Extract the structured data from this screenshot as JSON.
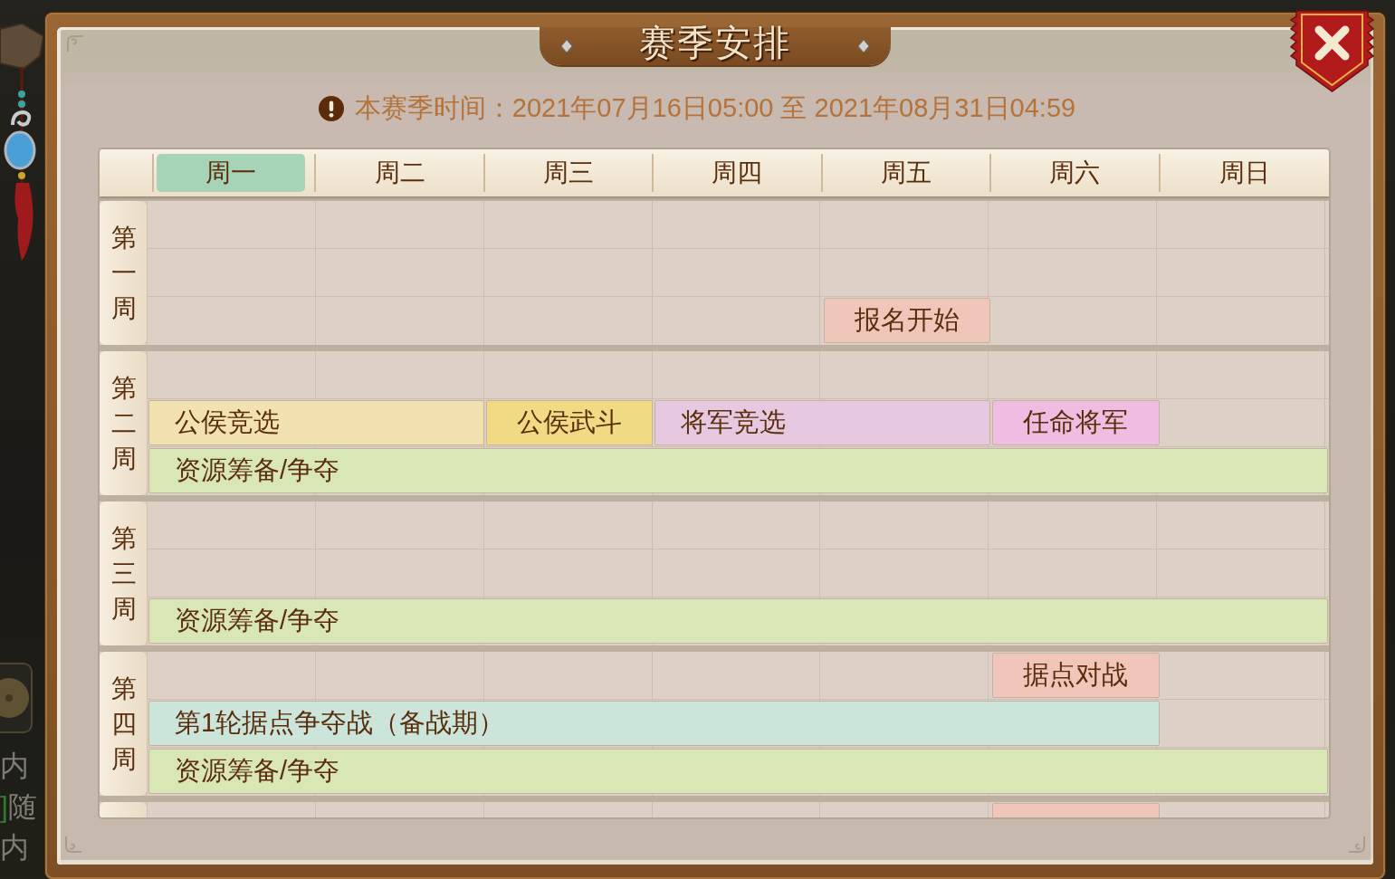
{
  "scene": {
    "chat_lines": [
      {
        "text": "内"
      },
      {
        "tag": "]",
        "text": "随"
      },
      {
        "text": "内"
      }
    ]
  },
  "dialog": {
    "title": "赛季安排",
    "notice": "本赛季时间：2021年07月16日05:00 至 2021年08月31日04:59"
  },
  "schedule": {
    "days": [
      {
        "label": "周一",
        "selected": true
      },
      {
        "label": "周二",
        "selected": false
      },
      {
        "label": "周三",
        "selected": false
      },
      {
        "label": "周四",
        "selected": false
      },
      {
        "label": "周五",
        "selected": false
      },
      {
        "label": "周六",
        "selected": false
      },
      {
        "label": "周日",
        "selected": false
      }
    ],
    "weeks": [
      {
        "label": "第一周",
        "lanes": [
          [
            {
              "kind": "empty"
            },
            {
              "kind": "empty"
            },
            {
              "kind": "empty"
            },
            {
              "kind": "empty"
            },
            {
              "kind": "empty"
            },
            {
              "kind": "empty"
            },
            {
              "kind": "empty"
            }
          ],
          [
            {
              "kind": "empty"
            },
            {
              "kind": "empty"
            },
            {
              "kind": "empty"
            },
            {
              "kind": "empty"
            },
            {
              "kind": "empty"
            },
            {
              "kind": "empty"
            },
            {
              "kind": "empty"
            }
          ],
          [
            {
              "kind": "empty"
            },
            {
              "kind": "empty"
            },
            {
              "kind": "empty"
            },
            {
              "kind": "empty"
            },
            {
              "kind": "event",
              "label": "报名开始",
              "color": "#f1c6ba"
            },
            {
              "kind": "empty"
            },
            {
              "kind": "empty"
            }
          ]
        ]
      },
      {
        "label": "第二周",
        "lanes": [
          [
            {
              "kind": "empty"
            },
            {
              "kind": "empty"
            },
            {
              "kind": "empty"
            },
            {
              "kind": "empty"
            },
            {
              "kind": "empty"
            },
            {
              "kind": "empty"
            },
            {
              "kind": "empty"
            }
          ],
          [
            {
              "kind": "event",
              "label": "公侯竞选",
              "color": "#f2e2b0"
            },
            {
              "kind": "continued"
            },
            {
              "kind": "event",
              "label": "公侯武斗",
              "color": "#f1da84"
            },
            {
              "kind": "event",
              "label": "将军竞选",
              "color": "#e6c9e1"
            },
            {
              "kind": "continued"
            },
            {
              "kind": "event",
              "label": "任命将军",
              "color": "#efbde2"
            },
            {
              "kind": "empty"
            }
          ],
          [
            {
              "kind": "event",
              "label": "资源筹备/争夺",
              "color": "#d9e6b6"
            },
            {
              "kind": "continued"
            },
            {
              "kind": "continued"
            },
            {
              "kind": "continued"
            },
            {
              "kind": "continued"
            },
            {
              "kind": "continued"
            },
            {
              "kind": "continued"
            }
          ]
        ]
      },
      {
        "label": "第三周",
        "lanes": [
          [
            {
              "kind": "empty"
            },
            {
              "kind": "empty"
            },
            {
              "kind": "empty"
            },
            {
              "kind": "empty"
            },
            {
              "kind": "empty"
            },
            {
              "kind": "empty"
            },
            {
              "kind": "empty"
            }
          ],
          [
            {
              "kind": "empty"
            },
            {
              "kind": "empty"
            },
            {
              "kind": "empty"
            },
            {
              "kind": "empty"
            },
            {
              "kind": "empty"
            },
            {
              "kind": "empty"
            },
            {
              "kind": "empty"
            }
          ],
          [
            {
              "kind": "event",
              "label": "资源筹备/争夺",
              "color": "#d9e6b6"
            },
            {
              "kind": "continued"
            },
            {
              "kind": "continued"
            },
            {
              "kind": "continued"
            },
            {
              "kind": "continued"
            },
            {
              "kind": "continued"
            },
            {
              "kind": "continued"
            }
          ]
        ]
      },
      {
        "label": "第四周",
        "lanes": [
          [
            {
              "kind": "empty"
            },
            {
              "kind": "empty"
            },
            {
              "kind": "empty"
            },
            {
              "kind": "empty"
            },
            {
              "kind": "empty"
            },
            {
              "kind": "event",
              "label": "据点对战",
              "color": "#f1c6ba"
            },
            {
              "kind": "empty"
            }
          ],
          [
            {
              "kind": "event",
              "label": "第1轮据点争夺战（备战期）",
              "color": "#cbe5db"
            },
            {
              "kind": "continued"
            },
            {
              "kind": "continued"
            },
            {
              "kind": "continued"
            },
            {
              "kind": "continued"
            },
            {
              "kind": "continued"
            },
            {
              "kind": "empty"
            }
          ],
          [
            {
              "kind": "event",
              "label": "资源筹备/争夺",
              "color": "#d9e6b6"
            },
            {
              "kind": "continued"
            },
            {
              "kind": "continued"
            },
            {
              "kind": "continued"
            },
            {
              "kind": "continued"
            },
            {
              "kind": "continued"
            },
            {
              "kind": "continued"
            }
          ]
        ]
      },
      {
        "lanes": [
          [
            {
              "kind": "empty"
            },
            {
              "kind": "empty"
            },
            {
              "kind": "empty"
            },
            {
              "kind": "empty"
            },
            {
              "kind": "empty"
            },
            {
              "kind": "event",
              "color": "#f1c6ba"
            },
            {
              "kind": "empty"
            }
          ]
        ]
      }
    ]
  }
}
